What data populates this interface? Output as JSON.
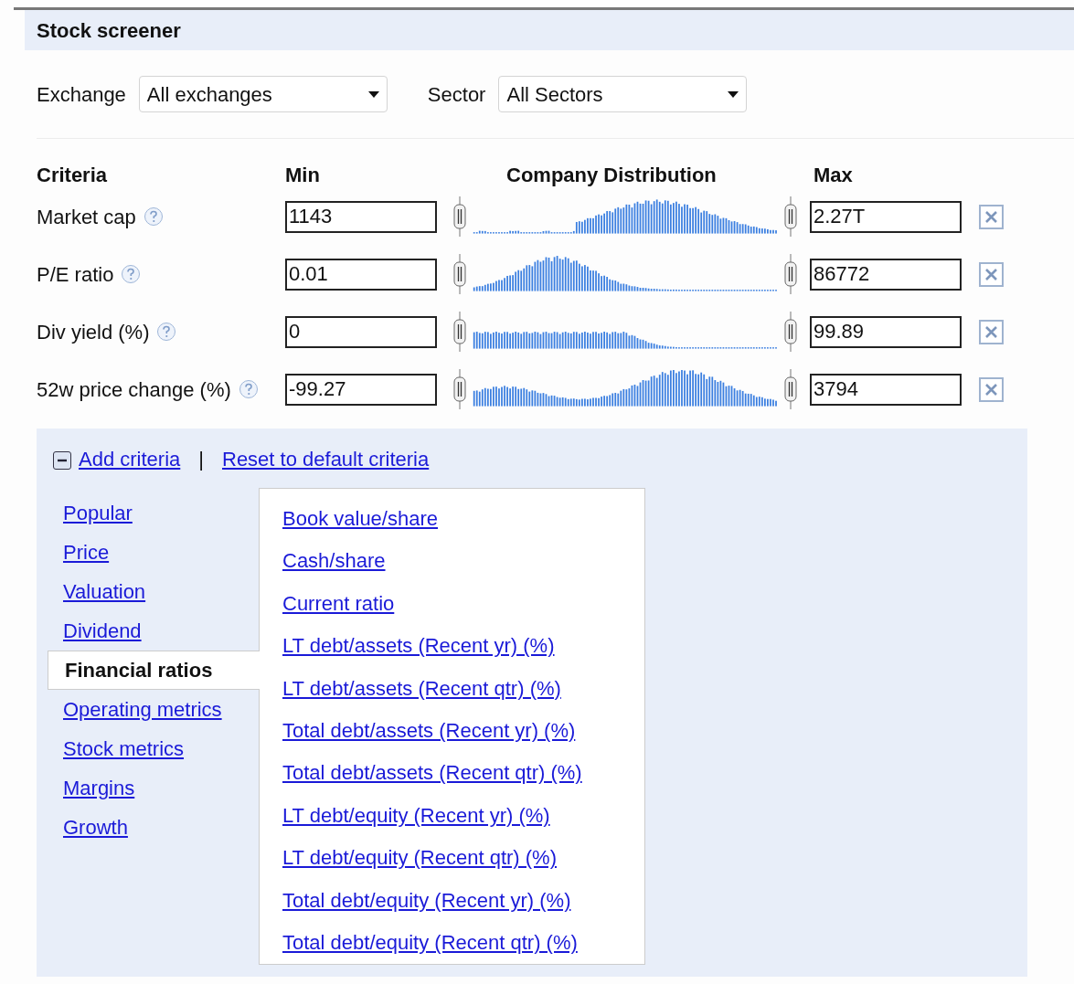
{
  "title": "Stock screener",
  "filters": [
    {
      "label": "Exchange",
      "value": "All exchanges"
    },
    {
      "label": "Sector",
      "value": "All Sectors"
    }
  ],
  "columns": {
    "criteria": "Criteria",
    "min": "Min",
    "distribution": "Company Distribution",
    "max": "Max"
  },
  "criteria": [
    {
      "name": "Market cap",
      "min": "1143",
      "max": "2.27T"
    },
    {
      "name": "P/E ratio",
      "min": "0.01",
      "max": "86772"
    },
    {
      "name": "Div yield (%)",
      "min": "0",
      "max": "99.89"
    },
    {
      "name": "52w price change (%)",
      "min": "-99.27",
      "max": "3794"
    }
  ],
  "add_criteria": {
    "label": "Add criteria",
    "expanded": true,
    "separator": "|",
    "reset": "Reset to default criteria"
  },
  "categories": [
    {
      "label": "Popular",
      "selected": false
    },
    {
      "label": "Price",
      "selected": false
    },
    {
      "label": "Valuation",
      "selected": false
    },
    {
      "label": "Dividend",
      "selected": false
    },
    {
      "label": "Financial ratios",
      "selected": true
    },
    {
      "label": "Operating metrics",
      "selected": false
    },
    {
      "label": "Stock metrics",
      "selected": false
    },
    {
      "label": "Margins",
      "selected": false
    },
    {
      "label": "Growth",
      "selected": false
    }
  ],
  "options": [
    "Book value/share",
    "Cash/share",
    "Current ratio",
    "LT debt/assets (Recent yr) (%)",
    "LT debt/assets (Recent qtr) (%)",
    "Total debt/assets (Recent yr) (%)",
    "Total debt/assets (Recent qtr) (%)",
    "LT debt/equity (Recent yr) (%)",
    "LT debt/equity (Recent qtr) (%)",
    "Total debt/equity (Recent yr) (%)",
    "Total debt/equity (Recent qtr) (%)"
  ]
}
